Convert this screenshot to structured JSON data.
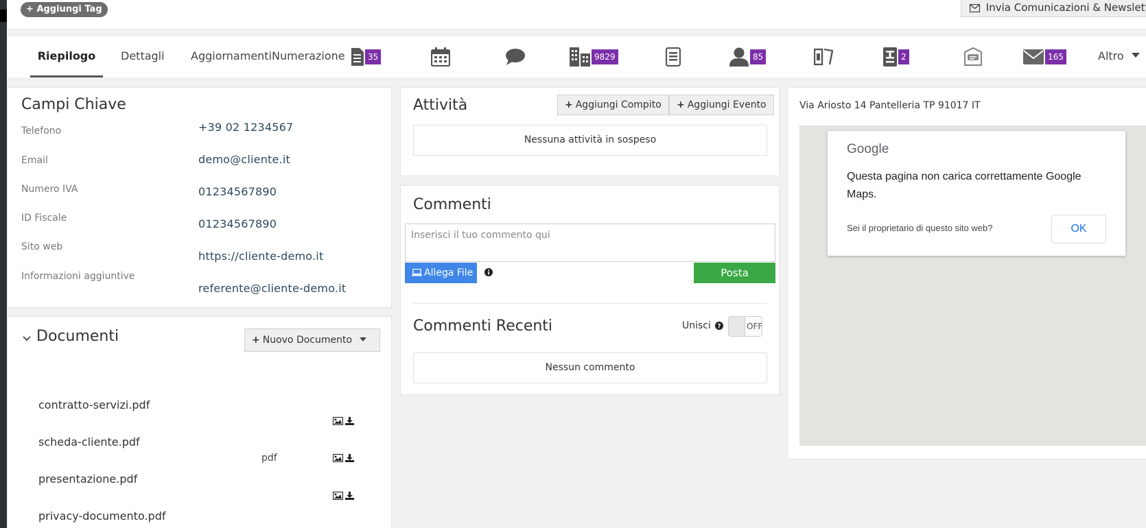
{
  "topbar": {
    "add_tag": "Aggiungi Tag",
    "newsletter": "Invia Comunicazioni & Newsletter"
  },
  "tabs": {
    "riepilogo": "Riepilogo",
    "dettagli": "Dettagli",
    "aggiornamenti": "Aggiornamenti",
    "numerazione": "Numerazione",
    "altro": "Altro",
    "badges": {
      "documents": "35",
      "companies": "9829",
      "contacts": "85",
      "reports": "2",
      "emails": "165"
    },
    "icons": [
      "document-icon",
      "calendar-icon",
      "comment-icon",
      "building-icon",
      "receipt-icon",
      "user-icon",
      "tickets-icon",
      "id-card-icon",
      "message-badge-icon",
      "envelope-icon"
    ]
  },
  "campi": {
    "title": "Campi Chiave",
    "fields": [
      {
        "label": "Telefono",
        "value": "+39 02 1234567"
      },
      {
        "label": "Email",
        "value": "demo@cliente.it"
      },
      {
        "label": "Numero IVA",
        "value": "01234567890"
      },
      {
        "label": "ID Fiscale",
        "value": "01234567890"
      },
      {
        "label": "Sito web",
        "value": "https://cliente-demo.it"
      },
      {
        "label": "Informazioni aggiuntive",
        "value": "referente@cliente-demo.it"
      }
    ]
  },
  "documenti": {
    "title": "Documenti",
    "new_button": "Nuovo Documento",
    "files": [
      {
        "name": "contratto-servizi.pdf",
        "type": ""
      },
      {
        "name": "scheda-cliente.pdf",
        "type": "pdf"
      },
      {
        "name": "presentazione.pdf",
        "type": ""
      },
      {
        "name": "privacy-documento.pdf",
        "type": ""
      }
    ]
  },
  "attivita": {
    "title": "Attività",
    "add_task": "Aggiungi Compito",
    "add_event": "Aggiungi Evento",
    "empty": "Nessuna attività in sospeso"
  },
  "commenti": {
    "title": "Commenti",
    "placeholder": "Inserisci il tuo commento qui",
    "attach": "Allega File",
    "post": "Posta",
    "recent_title": "Commenti Recenti",
    "merge_label": "Unisci",
    "toggle": "OFF",
    "empty": "Nessun commento"
  },
  "mappa": {
    "address": "Via Ariosto 14 Pantelleria TP 91017 IT",
    "google": "Google",
    "message": "Questa pagina non carica correttamente Google Maps.",
    "question": "Sei il proprietario di questo sito web?",
    "ok": "OK"
  },
  "colors": {
    "badge": "#7b2fa8",
    "attach": "#3f86e8",
    "post": "#39a845"
  }
}
